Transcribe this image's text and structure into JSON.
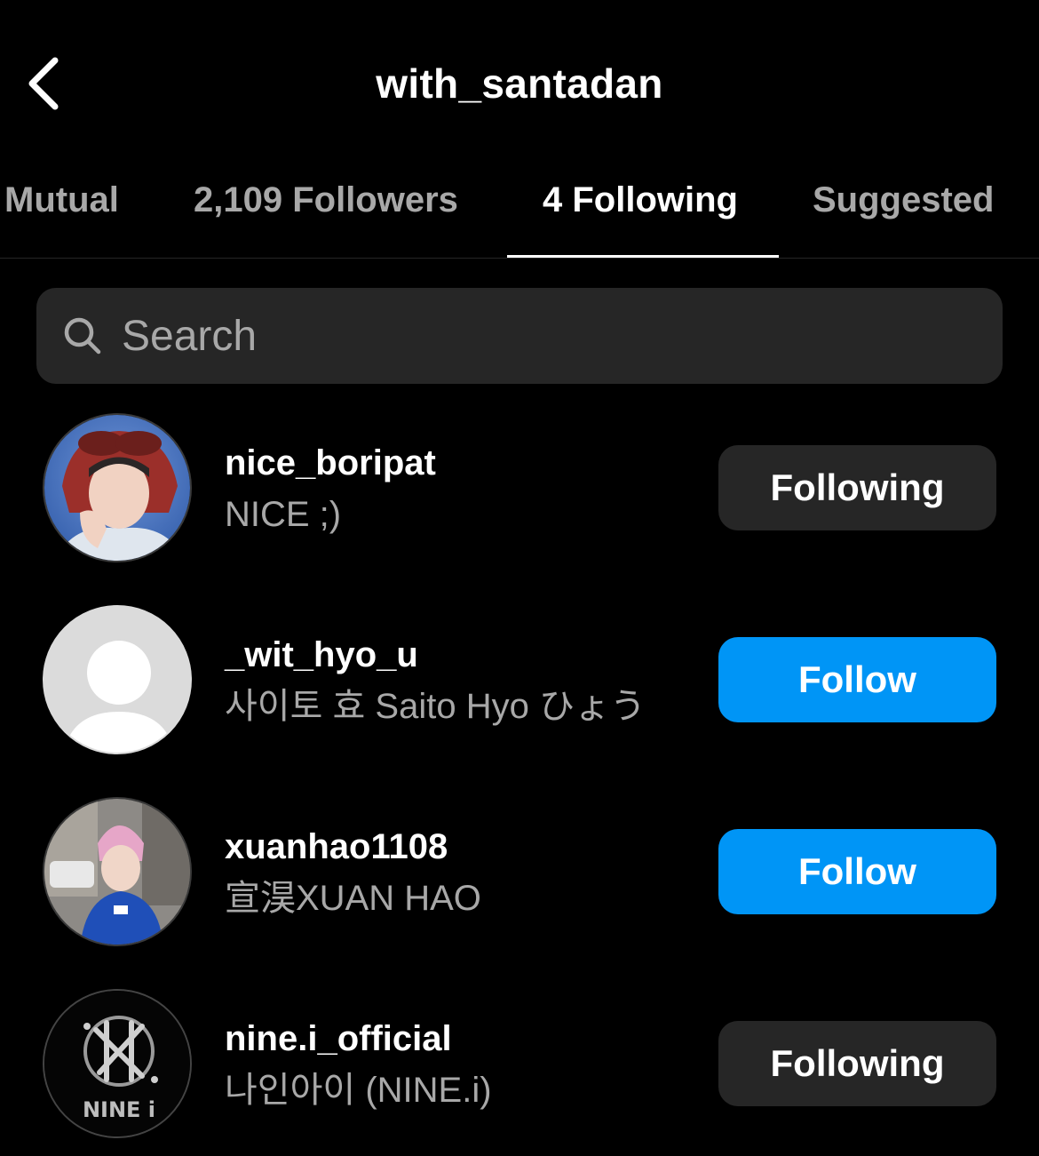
{
  "header": {
    "title": "with_santadan",
    "back_icon": "chevron-left-icon"
  },
  "tabs": [
    {
      "label": "Mutual",
      "active": false
    },
    {
      "label": "2,109 Followers",
      "active": false
    },
    {
      "label": "4 Following",
      "active": true
    },
    {
      "label": "Suggested",
      "active": false
    }
  ],
  "search": {
    "placeholder": "Search",
    "value": "",
    "icon": "search-icon"
  },
  "users": [
    {
      "username": "nice_boripat",
      "fullname": "NICE ;)",
      "button": "Following",
      "button_style": "following"
    },
    {
      "username": "_wit_hyo_u",
      "fullname": "사이토 효 Saito Hyo ひょう",
      "button": "Follow",
      "button_style": "follow"
    },
    {
      "username": "xuanhao1108",
      "fullname": "宣淏XUAN HAO",
      "button": "Follow",
      "button_style": "follow"
    },
    {
      "username": "nine.i_official",
      "fullname": "나인아이 (NINE.i)",
      "button": "Following",
      "button_style": "following"
    }
  ],
  "avatar_logo_text": "NINE i",
  "colors": {
    "background": "#000000",
    "secondary_text": "#a8a8a8",
    "button_dark": "#262626",
    "button_blue": "#0095f6"
  }
}
